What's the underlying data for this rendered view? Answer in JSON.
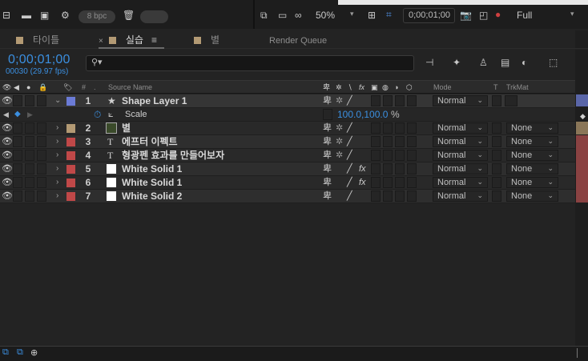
{
  "toolbar_left": {
    "bpc": "8 bpc"
  },
  "toolbar_right": {
    "zoom": "50%",
    "timecode": "0;00;01;00",
    "resolution": "Full"
  },
  "tabs": [
    {
      "label": "타이틀",
      "color": "#b39a74"
    },
    {
      "label": "실습",
      "color": "#b39a74",
      "active": true
    },
    {
      "label": "별",
      "color": "#b39a74"
    },
    {
      "label": "Render Queue"
    }
  ],
  "timeline": {
    "timecode": "0;00;01;00",
    "frame_info": "00030 (29.97 fps)",
    "search_placeholder": "",
    "columns": {
      "source_name": "Source Name",
      "mode": "Mode",
      "t": "T",
      "trkmat": "TrkMat"
    }
  },
  "layers": [
    {
      "num": "1",
      "name": "Shape Layer 1",
      "color": "#6b7bd6",
      "type": "shape",
      "mode": "Normal",
      "trkmat": "",
      "expanded": true
    },
    {
      "num": "2",
      "name": "별",
      "color": "#b39a74",
      "type": "comp",
      "mode": "Normal",
      "trkmat": "None"
    },
    {
      "num": "3",
      "name": "에프터 이펙트",
      "color": "#c04848",
      "type": "text",
      "mode": "Normal",
      "trkmat": "None"
    },
    {
      "num": "4",
      "name": "형광펜 효과를 만들어보자",
      "color": "#c04848",
      "type": "text",
      "mode": "Normal",
      "trkmat": "None"
    },
    {
      "num": "5",
      "name": "White Solid 1",
      "color": "#c04848",
      "type": "solid",
      "mode": "Normal",
      "trkmat": "None",
      "fx": true
    },
    {
      "num": "6",
      "name": "White Solid 1",
      "color": "#c04848",
      "type": "solid",
      "mode": "Normal",
      "trkmat": "None",
      "fx": true
    },
    {
      "num": "7",
      "name": "White Solid 2",
      "color": "#c04848",
      "type": "solid",
      "mode": "Normal",
      "trkmat": "None"
    }
  ],
  "property": {
    "name": "Scale",
    "value": "100.0,100.0",
    "unit": "%"
  }
}
